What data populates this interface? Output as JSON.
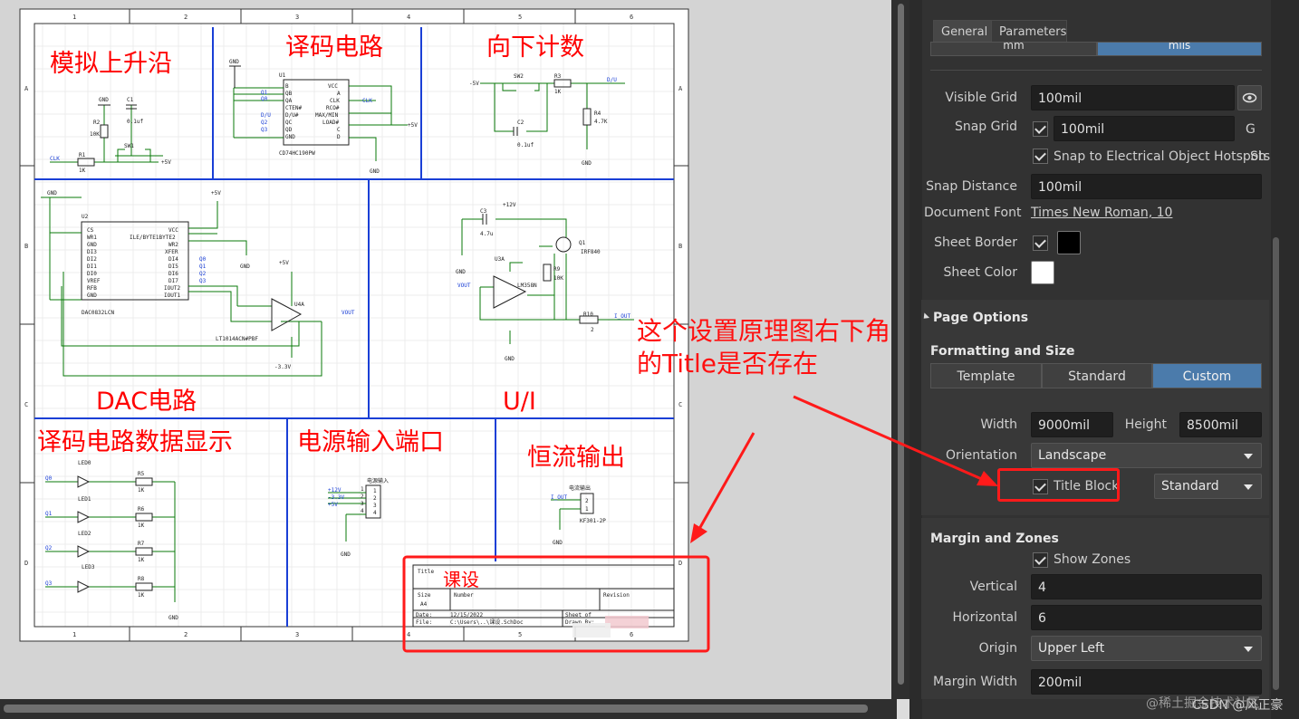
{
  "schematic": {
    "col_numbers": [
      "1",
      "2",
      "3",
      "4",
      "5",
      "6"
    ],
    "row_letters": [
      "A",
      "B",
      "C",
      "D"
    ],
    "region_titles": {
      "rising_edge": "模拟上升沿",
      "decoder": "译码电路",
      "down_count": "向下计数",
      "dac": "DAC电路",
      "ui": "U/I",
      "display": "译码电路数据显示",
      "power_port": "电源输入端口",
      "const_current": "恒流输出"
    },
    "parts": {
      "gnd": "GND",
      "c1": "C1",
      "c1_val": "0.1uf",
      "r2": "R2",
      "r2_val": "10K",
      "r1": "R1",
      "r1_val": "1K",
      "sw1": "SW1",
      "clk": "CLK",
      "v5": "+5V",
      "u1": "U1",
      "u1_part": "CD74HC190PW",
      "u1_pins_left": [
        "B",
        "QB",
        "QA",
        "CTEN#",
        "D/U#",
        "QC",
        "QD",
        "GND"
      ],
      "u1_pins_right": [
        "VCC",
        "A",
        "CLK",
        "RCO#",
        "MAX/MIN",
        "LOAD#",
        "C",
        "D"
      ],
      "u1_nums_left": [
        "1",
        "2",
        "3",
        "4",
        "5",
        "6",
        "7",
        "8"
      ],
      "u1_nums_right": [
        "16",
        "15",
        "14",
        "13",
        "12",
        "11",
        "10",
        "9"
      ],
      "u1_nets_left": [
        "Q1",
        "Q0",
        "",
        "D/U",
        "Q2",
        "Q3"
      ],
      "sw2": "SW2",
      "r3": "R3",
      "r3_val": "1K",
      "du": "D/U",
      "c2": "C2",
      "c2_val": "0.1uf",
      "r4": "R4",
      "r4_val": "4.7K",
      "neg5": "-5V",
      "u2": "U2",
      "u2_part": "DAC0832LCN",
      "u2_pins_left": [
        "CS",
        "WR1",
        "GND",
        "DI3",
        "DI2",
        "DI1",
        "DI0",
        "VREF",
        "RFB",
        "GND"
      ],
      "u2_pins_right": [
        "VCC",
        "ILE/BYTE1BYTE2",
        "WR2",
        "XFER",
        "DI4",
        "DI5",
        "DI6",
        "DI7",
        "IOUT2",
        "IOUT1"
      ],
      "u2_nums_left": [
        "1",
        "2",
        "3",
        "4",
        "5",
        "6",
        "7",
        "8",
        "9",
        "10"
      ],
      "u2_nums_right": [
        "20",
        "19",
        "18",
        "17",
        "16",
        "15",
        "14",
        "13",
        "12",
        "11"
      ],
      "u2_nets": [
        "Q0",
        "Q1",
        "Q2",
        "Q3"
      ],
      "u4": "U4A",
      "u4_part": "LT1014ACN#PBF",
      "vout": "VOUT",
      "neg33": "-3.3V",
      "c3": "C3",
      "c3_val": "4.7u",
      "v12": "+12V",
      "u3": "U3A",
      "u3_part": "LM358N",
      "q1": "Q1",
      "q1_part": "IRF840",
      "r9": "R9",
      "r9_val": "10K",
      "r10": "R10",
      "r10_val": "2",
      "iout": "I_OUT",
      "leds": [
        "LED0",
        "LED1",
        "LED2",
        "LED3"
      ],
      "led_nets": [
        "Q0",
        "Q1",
        "Q2",
        "Q3"
      ],
      "led_res": [
        "R5",
        "R6",
        "R7",
        "R8"
      ],
      "led_res_val": "1K",
      "pwr_title": "电源输入",
      "pwr_nets": [
        "+12V",
        "-3.3V",
        "+5V"
      ],
      "pwr_pins": [
        "1",
        "2",
        "3",
        "4"
      ],
      "cur_title": "电流输出",
      "cur_net": "I_OUT",
      "cur_part": "KF301-2P",
      "cur_pins": [
        "1",
        "2"
      ]
    },
    "title_block": {
      "title_label": "Title",
      "title_value": "课设",
      "size_label": "Size",
      "size_value": "A4",
      "number_label": "Number",
      "revision_label": "Revision",
      "date_label": "Date:",
      "date_value": "12/15/2022",
      "file_label": "File:",
      "file_value": "C:\\Users\\..\\课设.SchDoc",
      "sheet_label": "Sheet  of",
      "drawn_label": "Drawn By:"
    },
    "annotation": "这个设置原理图右下角的Title是否存在"
  },
  "panel": {
    "tabs": [
      "General",
      "Parameters"
    ],
    "units_partial": [
      "mm",
      "mils"
    ],
    "visible_grid_label": "Visible Grid",
    "visible_grid_value": "100mil",
    "snap_grid_label": "Snap Grid",
    "snap_grid_value": "100mil",
    "snap_grid_key": "G",
    "snap_hotspots_label": "Snap to Electrical Object Hotspots",
    "snap_hotspots_key": "Sh",
    "snap_distance_label": "Snap Distance",
    "snap_distance_value": "100mil",
    "document_font_label": "Document Font",
    "document_font_value": "Times New Roman, 10",
    "sheet_border_label": "Sheet Border",
    "sheet_color_label": "Sheet Color",
    "sheet_border_color": "#000000",
    "sheet_color": "#ffffff",
    "page_options_title": "Page Options",
    "formatting_title": "Formatting and Size",
    "format_tabs": [
      "Template",
      "Standard",
      "Custom"
    ],
    "width_label": "Width",
    "width_value": "9000mil",
    "height_label": "Height",
    "height_value": "8500mil",
    "orientation_label": "Orientation",
    "orientation_value": "Landscape",
    "title_block_label": "Title Block",
    "title_block_style": "Standard",
    "margin_title": "Margin and Zones",
    "show_zones_label": "Show Zones",
    "vertical_label": "Vertical",
    "vertical_value": "4",
    "horizontal_label": "Horizontal",
    "horizontal_value": "6",
    "origin_label": "Origin",
    "origin_value": "Upper Left",
    "margin_width_label": "Margin Width",
    "margin_width_value": "200mil"
  },
  "watermark": "@稀土掘金技术社区",
  "watermark2": "CSDN @风正豪",
  "colors": {
    "accent": "#4b7bab",
    "annotation": "#ff1010",
    "wire": "#0a7a0a",
    "divider": "#1a3fd6"
  }
}
